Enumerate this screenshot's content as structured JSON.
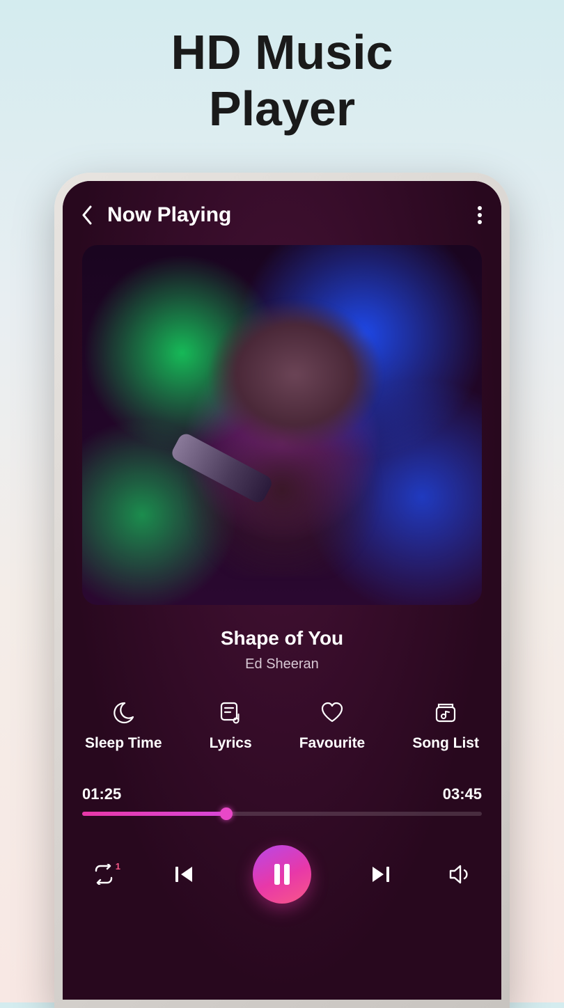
{
  "promo": {
    "title_line1": "HD Music",
    "title_line2": "Player"
  },
  "header": {
    "title": "Now Playing"
  },
  "track": {
    "title": "Shape of You",
    "artist": "Ed Sheeran"
  },
  "features": {
    "sleep_time": "Sleep Time",
    "lyrics": "Lyrics",
    "favourite": "Favourite",
    "song_list": "Song List"
  },
  "progress": {
    "elapsed": "01:25",
    "total": "03:45",
    "percent": 36
  },
  "repeat_count": "1"
}
